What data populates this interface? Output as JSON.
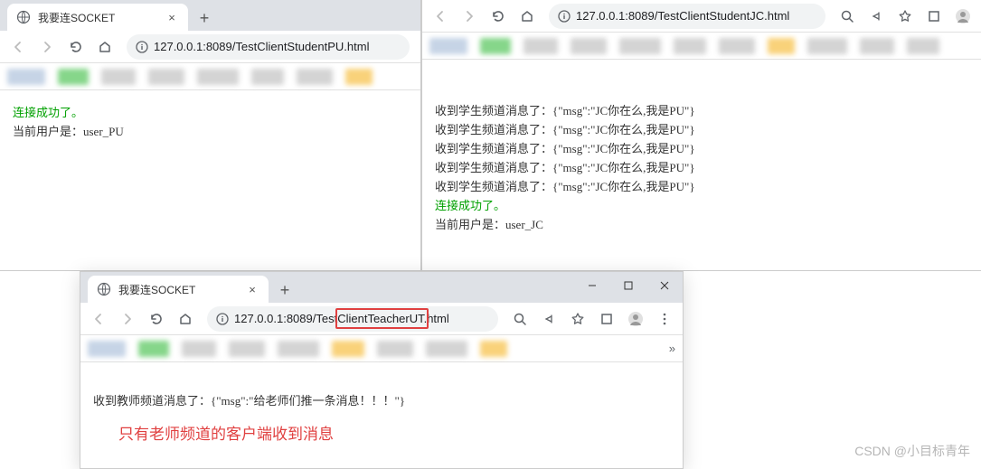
{
  "watermark": "CSDN @小目标青年",
  "windows": {
    "left": {
      "tab_title": "我要连SOCKET",
      "url": "127.0.0.1:8089/TestClientStudentPU.html",
      "content": {
        "success": "连接成功了。",
        "current_user": "当前用户是：user_PU"
      }
    },
    "right": {
      "url": "127.0.0.1:8089/TestClientStudentJC.html",
      "content": {
        "lines": [
          "收到学生频道消息了：{\"msg\":\"JC你在么,我是PU\"}",
          "收到学生频道消息了：{\"msg\":\"JC你在么,我是PU\"}",
          "收到学生频道消息了：{\"msg\":\"JC你在么,我是PU\"}",
          "收到学生频道消息了：{\"msg\":\"JC你在么,我是PU\"}",
          "收到学生频道消息了：{\"msg\":\"JC你在么,我是PU\"}"
        ],
        "success": "连接成功了。",
        "current_user": "当前用户是：user_JC"
      }
    },
    "bottom": {
      "tab_title": "我要连SOCKET",
      "url_prefix": "127.0.0.1:8089/Test",
      "url_highlight": "ClientTeacherUT.",
      "url_suffix": "html",
      "content": {
        "line": "收到教师频道消息了：{\"msg\":\"给老师们推一条消息！！！\"}",
        "note": "只有老师频道的客户端收到消息"
      }
    }
  }
}
